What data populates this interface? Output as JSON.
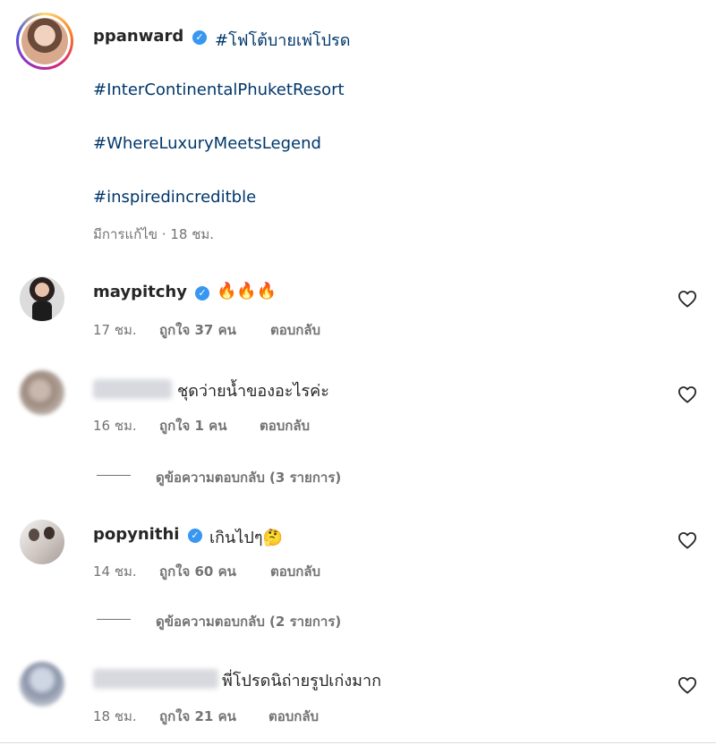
{
  "post": {
    "author": "ppanward",
    "hashtags": [
      "#โฟโต้บายเพ่โปรด",
      "#InterContinentalPhuketResort",
      "#WhereLuxuryMeetsLegend",
      "#inspiredincreditble"
    ],
    "edited_label": "มีการแก้ไข",
    "separator": "·",
    "time": "18 ชม."
  },
  "comments": [
    {
      "username": "maypitchy",
      "verified": true,
      "text": "🔥🔥🔥",
      "time": "17 ชม.",
      "likes": "ถูกใจ 37 คน",
      "reply": "ตอบกลับ"
    },
    {
      "username": "",
      "verified": false,
      "text": "ชุดว่ายน้ำของอะไรค่ะ",
      "time": "16 ชม.",
      "likes": "ถูกใจ 1 คน",
      "reply": "ตอบกลับ",
      "view_replies": "ดูข้อความตอบกลับ (3 รายการ)"
    },
    {
      "username": "popynithi",
      "verified": true,
      "text": "เกินไปๆ🤔",
      "time": "14 ชม.",
      "likes": "ถูกใจ 60 คน",
      "reply": "ตอบกลับ",
      "view_replies": "ดูข้อความตอบกลับ (2 รายการ)"
    },
    {
      "username": "",
      "verified": false,
      "text": "พี่โปรดนิถ่ายรูปเก่งมาก",
      "time": "18 ชม.",
      "likes": "ถูกใจ 21 คน",
      "reply": "ตอบกลับ"
    }
  ],
  "icons": {
    "verified": "verified-badge-icon",
    "like": "heart-outline-icon"
  },
  "colors": {
    "hashtag": "#00376b",
    "verified": "#3897f0",
    "muted": "#737373"
  }
}
